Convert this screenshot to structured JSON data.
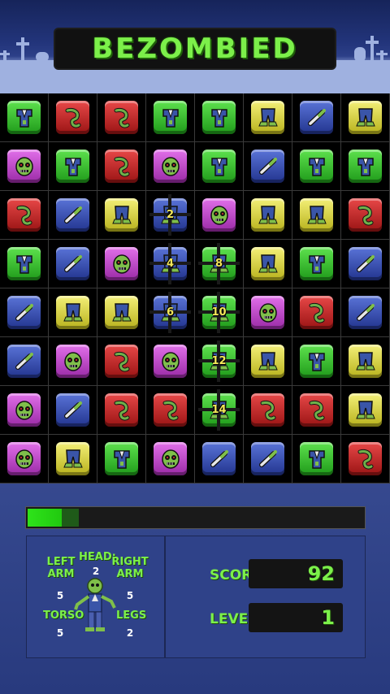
{
  "app": {
    "title": "BEZOMBIED"
  },
  "colors": {
    "green": "#3ec934",
    "red": "#c82828",
    "yellow": "#d6d246",
    "blue": "#3a52b6",
    "purple": "#c24ed0"
  },
  "piece_icons": {
    "torso": "torso-icon",
    "arm": "arm-icon",
    "legs": "legs-icon",
    "head": "zombie-head-icon"
  },
  "board": {
    "rows": [
      [
        [
          "green",
          "torso"
        ],
        [
          "red",
          "arm"
        ],
        [
          "red",
          "arm"
        ],
        [
          "green",
          "torso"
        ],
        [
          "green",
          "torso"
        ],
        [
          "yellow",
          "legs"
        ],
        [
          "blue",
          "arm"
        ],
        [
          "yellow",
          "legs"
        ]
      ],
      [
        [
          "purple",
          "head"
        ],
        [
          "green",
          "torso"
        ],
        [
          "red",
          "arm"
        ],
        [
          "purple",
          "head"
        ],
        [
          "green",
          "torso"
        ],
        [
          "blue",
          "arm"
        ],
        [
          "green",
          "torso"
        ],
        [
          "green",
          "torso"
        ]
      ],
      [
        [
          "red",
          "arm"
        ],
        [
          "blue",
          "arm"
        ],
        [
          "yellow",
          "legs"
        ],
        [
          "blue",
          "legs"
        ],
        [
          "purple",
          "head"
        ],
        [
          "yellow",
          "legs"
        ],
        [
          "yellow",
          "legs"
        ],
        [
          "red",
          "arm"
        ]
      ],
      [
        [
          "green",
          "torso"
        ],
        [
          "blue",
          "arm"
        ],
        [
          "purple",
          "head"
        ],
        [
          "blue",
          "legs"
        ],
        [
          "green",
          "legs"
        ],
        [
          "yellow",
          "legs"
        ],
        [
          "green",
          "torso"
        ],
        [
          "blue",
          "arm"
        ]
      ],
      [
        [
          "blue",
          "arm"
        ],
        [
          "yellow",
          "legs"
        ],
        [
          "yellow",
          "legs"
        ],
        [
          "blue",
          "legs"
        ],
        [
          "green",
          "legs"
        ],
        [
          "purple",
          "head"
        ],
        [
          "red",
          "arm"
        ],
        [
          "blue",
          "arm"
        ]
      ],
      [
        [
          "blue",
          "arm"
        ],
        [
          "purple",
          "head"
        ],
        [
          "red",
          "arm"
        ],
        [
          "purple",
          "head"
        ],
        [
          "green",
          "legs"
        ],
        [
          "yellow",
          "legs"
        ],
        [
          "green",
          "torso"
        ],
        [
          "yellow",
          "legs"
        ]
      ],
      [
        [
          "purple",
          "head"
        ],
        [
          "blue",
          "arm"
        ],
        [
          "red",
          "arm"
        ],
        [
          "red",
          "arm"
        ],
        [
          "green",
          "legs"
        ],
        [
          "red",
          "arm"
        ],
        [
          "red",
          "arm"
        ],
        [
          "yellow",
          "legs"
        ]
      ],
      [
        [
          "purple",
          "head"
        ],
        [
          "yellow",
          "legs"
        ],
        [
          "green",
          "torso"
        ],
        [
          "purple",
          "head"
        ],
        [
          "blue",
          "arm"
        ],
        [
          "blue",
          "arm"
        ],
        [
          "green",
          "torso"
        ],
        [
          "red",
          "arm"
        ]
      ]
    ],
    "combo_markers": [
      {
        "row": 2,
        "col": 3,
        "label": "2"
      },
      {
        "row": 3,
        "col": 3,
        "label": "4"
      },
      {
        "row": 3,
        "col": 4,
        "label": "8"
      },
      {
        "row": 4,
        "col": 3,
        "label": "6"
      },
      {
        "row": 4,
        "col": 4,
        "label": "10"
      },
      {
        "row": 5,
        "col": 4,
        "label": "12"
      },
      {
        "row": 6,
        "col": 4,
        "label": "14"
      }
    ]
  },
  "progress": {
    "value": 0.1,
    "trail": 0.05
  },
  "body_parts": {
    "left_arm": {
      "label": "LEFT ARM",
      "count": "5"
    },
    "head": {
      "label": "HEAD:",
      "count": "2"
    },
    "right_arm": {
      "label": "RIGHT ARM",
      "count": "5"
    },
    "torso": {
      "label": "TORSO",
      "count": "5"
    },
    "legs": {
      "label": "LEGS",
      "count": "2"
    }
  },
  "stats": {
    "score_label": "SCORE:",
    "score": "92",
    "level_label": "LEVEL:",
    "level": "1"
  }
}
